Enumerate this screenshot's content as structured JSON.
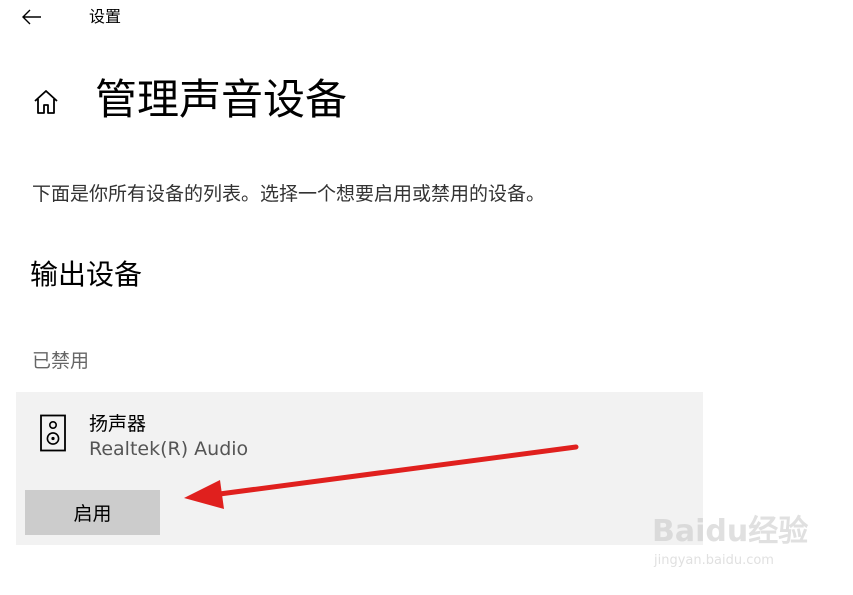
{
  "window": {
    "title": "设置"
  },
  "header": {
    "home_icon": "home-icon",
    "page_title": "管理声音设备"
  },
  "main": {
    "description": "下面是你所有设备的列表。选择一个想要启用或禁用的设备。",
    "section_heading": "输出设备",
    "status_label": "已禁用",
    "device": {
      "icon": "speaker-icon",
      "name": "扬声器",
      "driver": "Realtek(R) Audio",
      "enable_button_label": "启用"
    }
  },
  "annotation": {
    "arrow_color": "#e0201e"
  },
  "watermark": {
    "brand": "Baidu经验",
    "url": "jingyan.baidu.com"
  },
  "colors": {
    "card_background": "#f2f2f2",
    "button_background": "#cccccc"
  }
}
